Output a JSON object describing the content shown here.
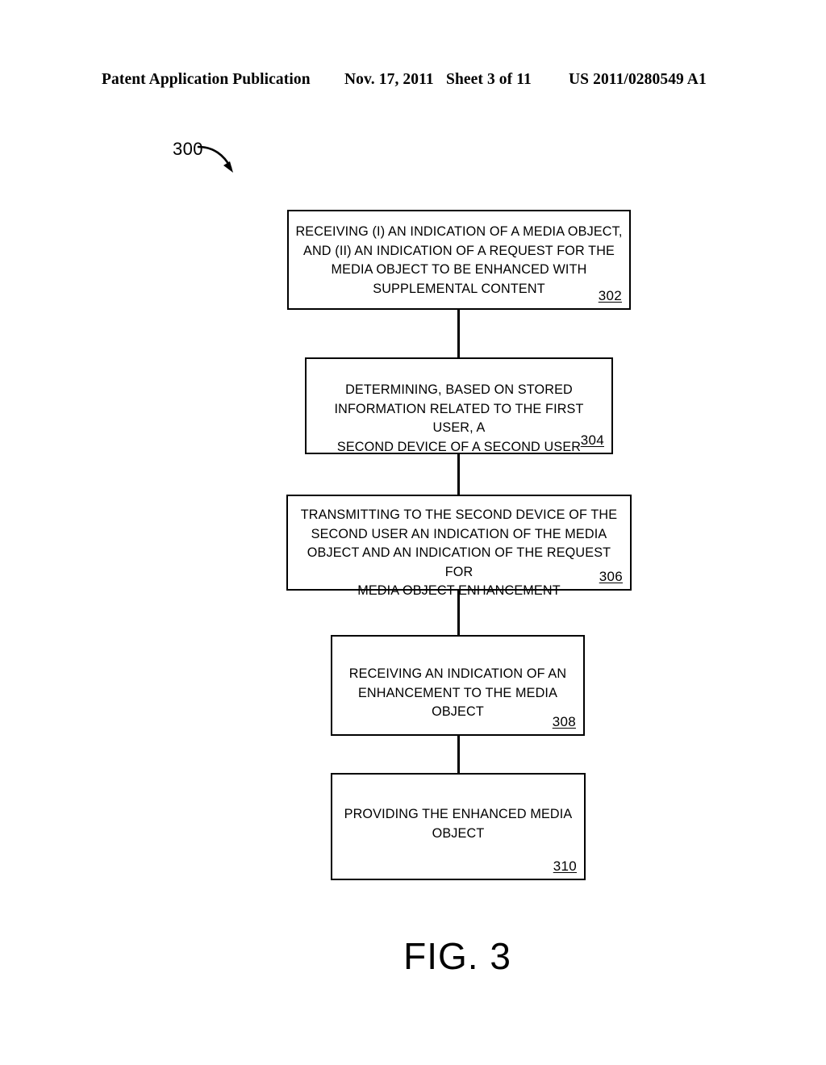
{
  "header": {
    "publication": "Patent Application Publication",
    "date": "Nov. 17, 2011",
    "sheet": "Sheet 3 of 11",
    "document_number": "US 2011/0280549 A1"
  },
  "figure": {
    "callout_label": "300",
    "callout_arrow_icon": "curved-arrow-icon",
    "caption": "FIG. 3"
  },
  "flowchart": {
    "steps": [
      {
        "ref": "302",
        "text": "RECEIVING (I) AN INDICATION OF A MEDIA OBJECT,\nAND (II) AN INDICATION OF A REQUEST FOR THE\nMEDIA OBJECT TO BE ENHANCED WITH\nSUPPLEMENTAL CONTENT"
      },
      {
        "ref": "304",
        "text": "DETERMINING, BASED ON STORED\nINFORMATION RELATED TO THE FIRST USER, A\nSECOND DEVICE OF A SECOND USER"
      },
      {
        "ref": "306",
        "text": "TRANSMITTING TO THE SECOND DEVICE OF THE\nSECOND USER AN INDICATION OF THE MEDIA\nOBJECT AND AN INDICATION OF THE REQUEST FOR\nMEDIA OBJECT ENHANCEMENT"
      },
      {
        "ref": "308",
        "text": "RECEIVING AN INDICATION OF AN\nENHANCEMENT TO THE MEDIA OBJECT"
      },
      {
        "ref": "310",
        "text": "PROVIDING THE ENHANCED MEDIA\nOBJECT"
      }
    ],
    "connectors": [
      {
        "from": "302",
        "to": "304"
      },
      {
        "from": "304",
        "to": "306"
      },
      {
        "from": "306",
        "to": "308"
      },
      {
        "from": "308",
        "to": "310"
      }
    ]
  },
  "colors": {
    "ink": "#000000",
    "paper": "#ffffff"
  }
}
